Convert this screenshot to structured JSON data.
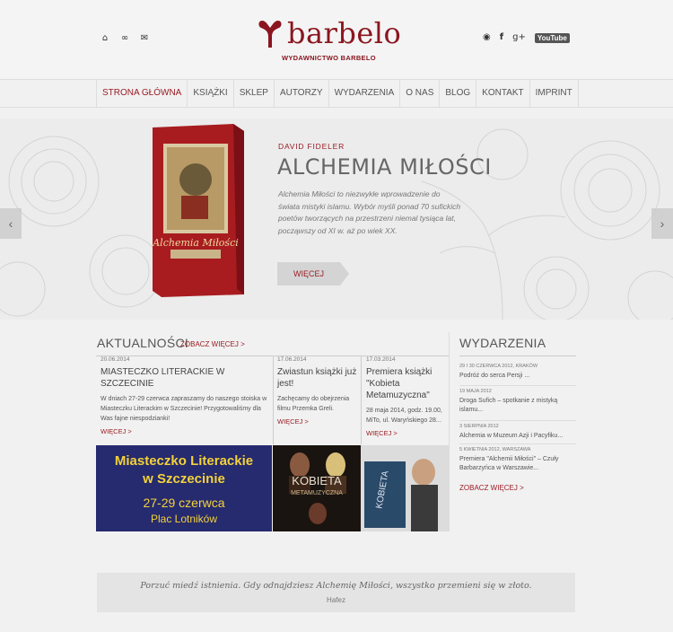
{
  "header": {
    "logo_text": "barbelo",
    "logo_subtitle": "WYDAWNICTWO BARBELO",
    "top_icons": [
      "home-icon",
      "link-icon",
      "mail-icon"
    ],
    "social": {
      "youtube_label": "YouTube"
    }
  },
  "nav": {
    "items": [
      "STRONA GŁÓWNA",
      "KSIĄŻKI",
      "SKLEP",
      "AUTORZY",
      "WYDARZENIA",
      "O NAS",
      "BLOG",
      "KONTAKT",
      "IMPRINT"
    ],
    "active_index": 0
  },
  "hero": {
    "author": "DAVID FIDELER",
    "title": "ALCHEMIA MIŁOŚCI",
    "description": "Alchemia Miłości to niezwykłe wprowadzenie do świata mistyki islamu. Wybór myśli ponad 70 sufickich poetów tworzących na przestrzeni niemal tysiąca lat, począwszy od XI w. aż po wiek XX.",
    "button": "WIĘCEJ",
    "book_cover_title": "Alchemia Miłości"
  },
  "news": {
    "title": "AKTUALNOŚCI",
    "see_more": "ZOBACZ WIĘCEJ >",
    "items": [
      {
        "date": "20.06.2014",
        "title": "MIASTECZKO LITERACKIE W SZCZECINIE",
        "text": "W dniach 27-29 czerwca zapraszamy do naszego stoiska w Miasteczku Literackim w Szczecinie! Przygotowaliśmy dla Was fajne niespodzianki!",
        "more": "WIĘCEJ >"
      },
      {
        "date": "17.06.2014",
        "title": "Zwiastun książki już jest!",
        "text": "Zachęcamy do obejrzenia filmu Przemka Greli.",
        "more": "WIĘCEJ >"
      },
      {
        "date": "17.03.2014",
        "title": "Premiera książki \"Kobieta Metamuzyczna\"",
        "text": "28 maja 2014, godz. 19.00, MiTo, ul. Waryńskiego 28...",
        "more": "WIĘCEJ >"
      }
    ],
    "tile1": {
      "line1": "Miasteczko Literackie",
      "line2": "w Szczecinie",
      "line3": "27-29 czerwca",
      "line4": "Plac Lotników"
    },
    "tile2": {
      "line1": "KOBIETA",
      "line2": "METAMUZYCZNA"
    },
    "tile3": {
      "line1": "KOBIETA"
    }
  },
  "events": {
    "title": "WYDARZENIA",
    "items": [
      {
        "date": "29 I 30 CZERWCA 2012, KRAKÓW",
        "title": "Podróż do serca Persji ..."
      },
      {
        "date": "19 MAJA 2012",
        "title": "Droga Sufich – spotkanie z mistyką islamu..."
      },
      {
        "date": "3 SIERPNIA 2012",
        "title": "Alchemia w Muzeum Azji i Pacyfiku..."
      },
      {
        "date": "5 KWIETNIA 2012, WARSZAWA",
        "title": "Premiera \"Alchemii Miłości\" – Czuły Barbarzyńca w Warszawie..."
      }
    ],
    "see_more": "ZOBACZ WIĘCEJ >"
  },
  "quote": {
    "text": "Porzuć miedź istnienia. Gdy odnajdziesz Alchemię Miłości, wszystko przemieni się w złoto.",
    "author": "Hafez"
  },
  "colors": {
    "accent": "#9a1c24",
    "background": "#f1f1f1"
  }
}
